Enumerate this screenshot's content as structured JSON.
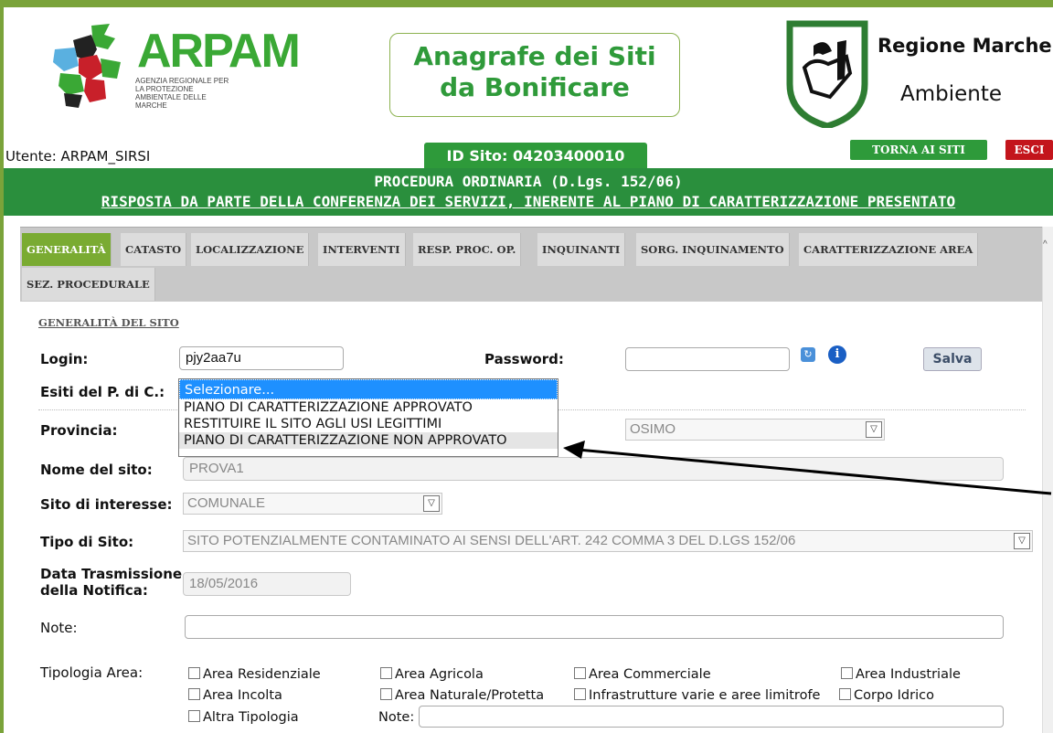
{
  "header": {
    "arpam_logo_text": "ARPAM",
    "arpam_subtitle": "AGENZIA REGIONALE PER LA PROTEZIONE AMBIENTALE DELLE MARCHE",
    "title_line1": "Anagrafe dei Siti",
    "title_line2": "da Bonificare",
    "regione_name": "Regione Marche",
    "regione_sub": "Ambiente"
  },
  "userbar": {
    "utente": "Utente: ARPAM_SIRSI",
    "id_sito": "ID Sito: 04203400010",
    "torna_label": "TORNA AI SITI",
    "esci_label": "ESCI"
  },
  "banner": {
    "line1": "PROCEDURA ORDINARIA (D.Lgs. 152/06)",
    "line2": "RISPOSTA DA PARTE DELLA CONFERENZA DEI SERVIZI, INERENTE AL PIANO DI CARATTERIZZAZIONE PRESENTATO"
  },
  "tabs": [
    "GENERALITÀ",
    "CATASTO",
    "LOCALIZZAZIONE",
    "INTERVENTI",
    "RESP. PROC. OP.",
    "INQUINANTI",
    "SORG. INQUINAMENTO",
    "CARATTERIZZAZIONE AREA",
    "SEZ. PROCEDURALE"
  ],
  "form": {
    "section_title": "GENERALITÀ DEL SITO",
    "login_label": "Login:",
    "login_value": "pjy2aa7u",
    "password_label": "Password:",
    "password_value": "",
    "salva_label": "Salva",
    "esiti_label": "Esiti del P. di C.:",
    "esiti_options": [
      "Selezionare...",
      "PIANO DI CARATTERIZZAZIONE APPROVATO",
      "RESTITUIRE IL SITO AGLI USI LEGITTIMI",
      "PIANO DI CARATTERIZZAZIONE NON APPROVATO"
    ],
    "provincia_label": "Provincia:",
    "comune_value": "OSIMO",
    "nome_label": "Nome del sito:",
    "nome_value": "PROVA1",
    "interesse_label": "Sito di interesse:",
    "interesse_value": "COMUNALE",
    "tipo_label": "Tipo di Sito:",
    "tipo_value": "SITO POTENZIALMENTE CONTAMINATO AI SENSI DELL'ART. 242 COMMA 3 DEL D.LGS 152/06",
    "data_label_1": "Data Trasmissione",
    "data_label_2": "della Notifica:",
    "data_value": "18/05/2016",
    "note_label": "Note:",
    "note_value": "",
    "tipologia_label": "Tipologia Area:",
    "tipologia_options": [
      "Area Residenziale",
      "Area Agricola",
      "Area Commerciale",
      "Area Industriale",
      "Area Incolta",
      "Area Naturale/Protetta",
      "Infrastrutture varie e aree limitrofe",
      "Corpo Idrico",
      "Altra Tipologia"
    ],
    "tipologia_note_label": "Note:"
  },
  "colors": {
    "brand_green": "#2e9a3a",
    "tab_active": "#7aab32",
    "esci_red": "#c3151c",
    "selection_blue": "#1e90ff"
  }
}
